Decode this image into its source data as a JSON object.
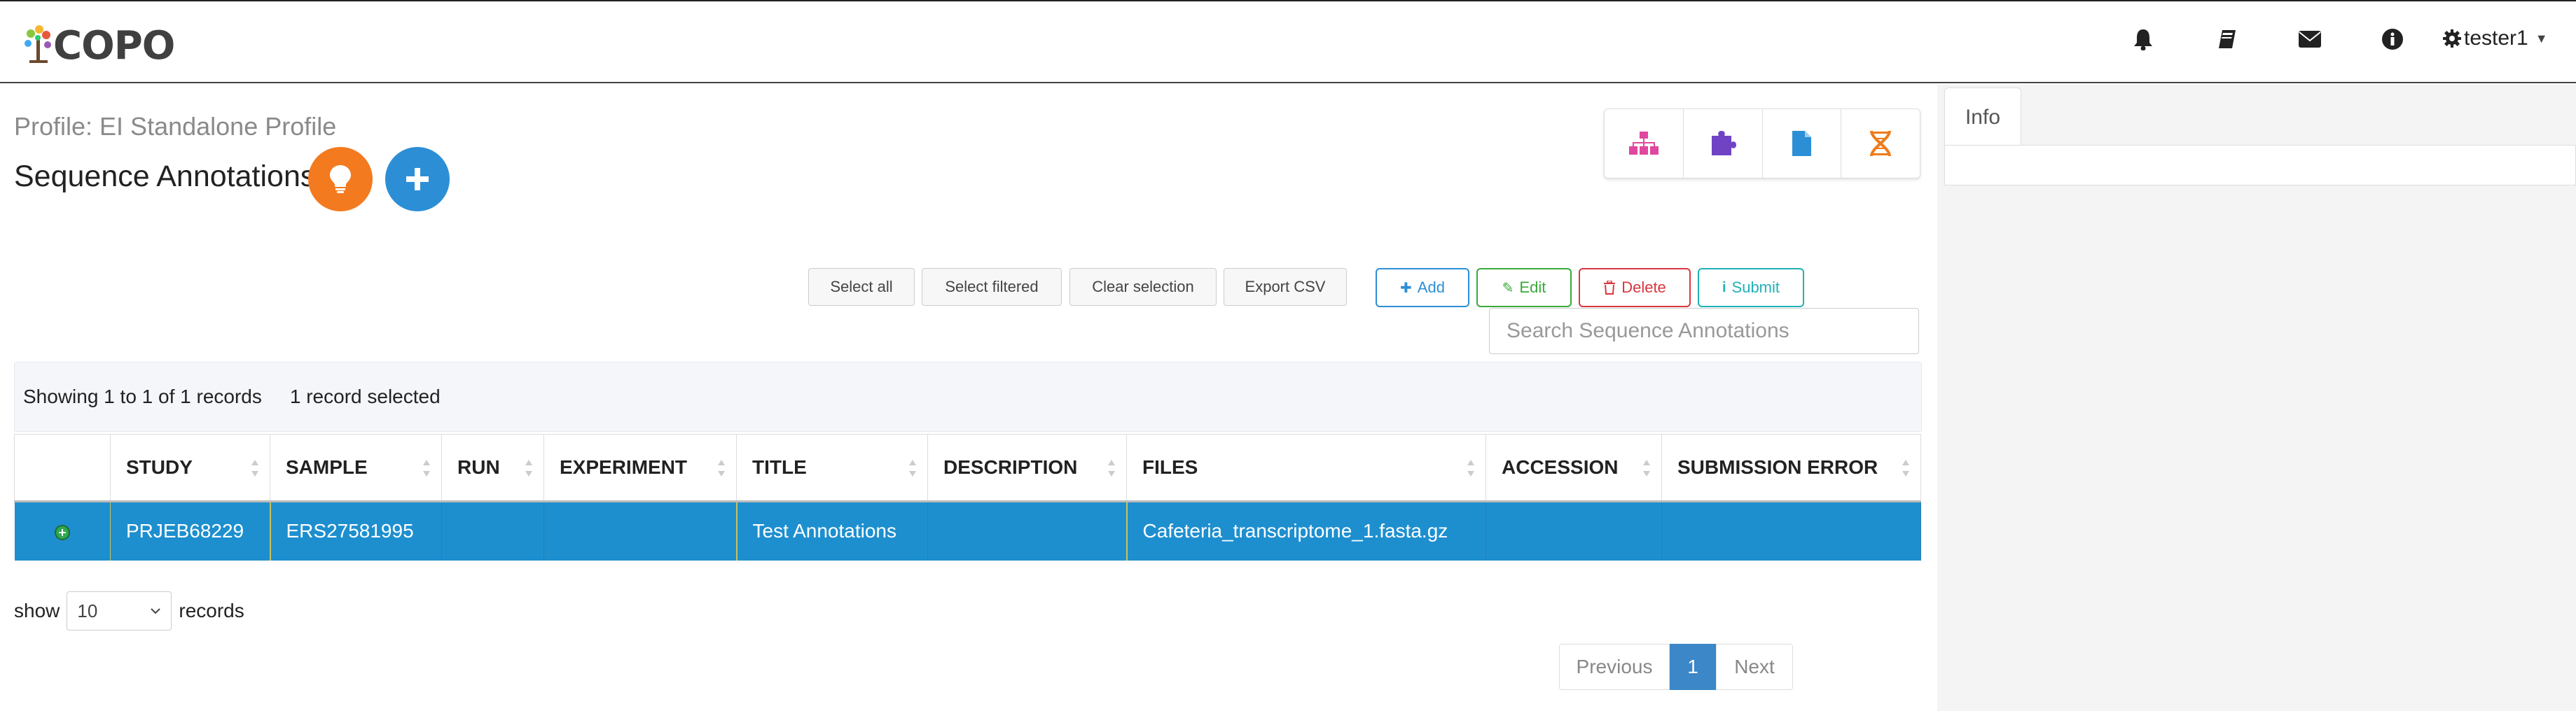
{
  "navbar": {
    "brand": "COPO",
    "icons": [
      "bell-icon",
      "book-icon",
      "envelope-icon",
      "info-icon"
    ],
    "user": "tester1"
  },
  "header": {
    "profile": "Profile: EI Standalone Profile",
    "title": "Sequence Annotations"
  },
  "info_panel": {
    "tab_label": "Info"
  },
  "selection_buttons": {
    "select_all": "Select all",
    "select_filtered": "Select filtered",
    "clear_selection": "Clear selection",
    "export_csv": "Export CSV"
  },
  "action_buttons": {
    "add": "Add",
    "edit": "Edit",
    "delete": "Delete",
    "submit": "Submit"
  },
  "search": {
    "placeholder": "Search Sequence Annotations"
  },
  "table_info": {
    "showing": "Showing 1 to 1 of 1 records",
    "selected": "1 record selected"
  },
  "table": {
    "columns": [
      "STUDY",
      "SAMPLE",
      "RUN",
      "EXPERIMENT",
      "TITLE",
      "DESCRIPTION",
      "FILES",
      "ACCESSION",
      "SUBMISSION ERROR"
    ],
    "rows": [
      {
        "study": "PRJEB68229",
        "sample": "ERS27581995",
        "run": "",
        "experiment": "",
        "title": "Test Annotations",
        "description": "",
        "files": "Cafeteria_transcriptome_1.fasta.gz",
        "accession": "",
        "submission_error": ""
      }
    ]
  },
  "length_menu": {
    "prefix": "show",
    "value": "10",
    "suffix": "records"
  },
  "pagination": {
    "previous": "Previous",
    "current": "1",
    "next": "Next"
  },
  "colors": {
    "selected_row": "#1d8fcf",
    "orange_button": "#f47a1f",
    "blue_button": "#2c8fd6",
    "add": "#2c8fd6",
    "edit": "#3aa93a",
    "delete": "#d9363e",
    "submit": "#1fb1b6"
  }
}
